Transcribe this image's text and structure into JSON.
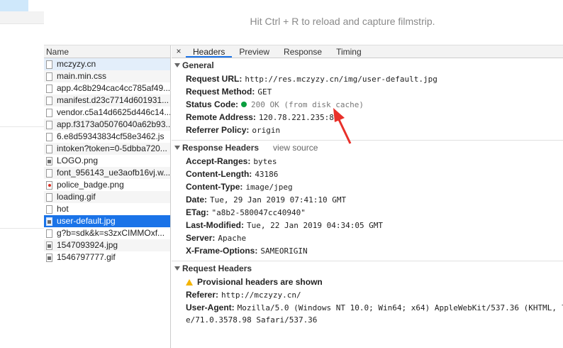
{
  "filmstrip": {
    "hint": "Hit Ctrl + R to reload and capture filmstrip."
  },
  "name_panel": {
    "header": "Name",
    "requests": [
      {
        "name": "mczyzy.cn",
        "icon": "doc"
      },
      {
        "name": "main.min.css",
        "icon": "doc"
      },
      {
        "name": "app.4c8b294cac4cc785af49...",
        "icon": "doc"
      },
      {
        "name": "manifest.d23c7714d601931...",
        "icon": "doc"
      },
      {
        "name": "vendor.c5a14d6625d446c14...",
        "icon": "doc"
      },
      {
        "name": "app.f3173a05076040a62b93...",
        "icon": "doc"
      },
      {
        "name": "6.e8d59343834cf58e3462.js",
        "icon": "doc"
      },
      {
        "name": "intoken?token=0-5dbba720...",
        "icon": "doc"
      },
      {
        "name": "LOGO.png",
        "icon": "img"
      },
      {
        "name": "font_956143_ue3aofb16vj.w...",
        "icon": "doc"
      },
      {
        "name": "police_badge.png",
        "icon": "img-red"
      },
      {
        "name": "loading.gif",
        "icon": "doc"
      },
      {
        "name": "hot",
        "icon": "doc"
      },
      {
        "name": "user-default.jpg",
        "icon": "img"
      },
      {
        "name": "g?b=sdk&k=s3zxCIMMOxf...",
        "icon": "doc"
      },
      {
        "name": "1547093924.jpg",
        "icon": "img"
      },
      {
        "name": "1546797777.gif",
        "icon": "img"
      }
    ]
  },
  "tabs": {
    "close": "×",
    "items": [
      "Headers",
      "Preview",
      "Response",
      "Timing"
    ]
  },
  "general": {
    "title": "General",
    "request_url_k": "Request URL:",
    "request_url_v": "http://res.mczyzy.cn/img/user-default.jpg",
    "request_method_k": "Request Method:",
    "request_method_v": "GET",
    "status_code_k": "Status Code:",
    "status_code_v": "200 OK (from disk cache)",
    "remote_address_k": "Remote Address:",
    "remote_address_v": "120.78.221.235:80",
    "referrer_policy_k": "Referrer Policy:",
    "referrer_policy_v": "origin"
  },
  "response_headers": {
    "title": "Response Headers",
    "view_source": "view source",
    "items": [
      {
        "k": "Accept-Ranges:",
        "v": "bytes"
      },
      {
        "k": "Content-Length:",
        "v": "43186"
      },
      {
        "k": "Content-Type:",
        "v": "image/jpeg"
      },
      {
        "k": "Date:",
        "v": "Tue, 29 Jan 2019 07:41:10 GMT"
      },
      {
        "k": "ETag:",
        "v": "\"a8b2-580047cc40940\""
      },
      {
        "k": "Last-Modified:",
        "v": "Tue, 22 Jan 2019 04:34:05 GMT"
      },
      {
        "k": "Server:",
        "v": "Apache"
      },
      {
        "k": "X-Frame-Options:",
        "v": "SAMEORIGIN"
      }
    ]
  },
  "request_headers": {
    "title": "Request Headers",
    "warning": "Provisional headers are shown",
    "referer_k": "Referer:",
    "referer_v": "http://mczyzy.cn/",
    "user_agent_k": "User-Agent:",
    "user_agent_v1": "Mozilla/5.0 (Windows NT 10.0; Win64; x64) AppleWebKit/537.36 (KHTML, l",
    "user_agent_v2": "e/71.0.3578.98 Safari/537.36"
  },
  "colors": {
    "selected_row": "#1a73e8",
    "status_ok": "#0a9e3f",
    "annotation_arrow": "#e8302a"
  }
}
